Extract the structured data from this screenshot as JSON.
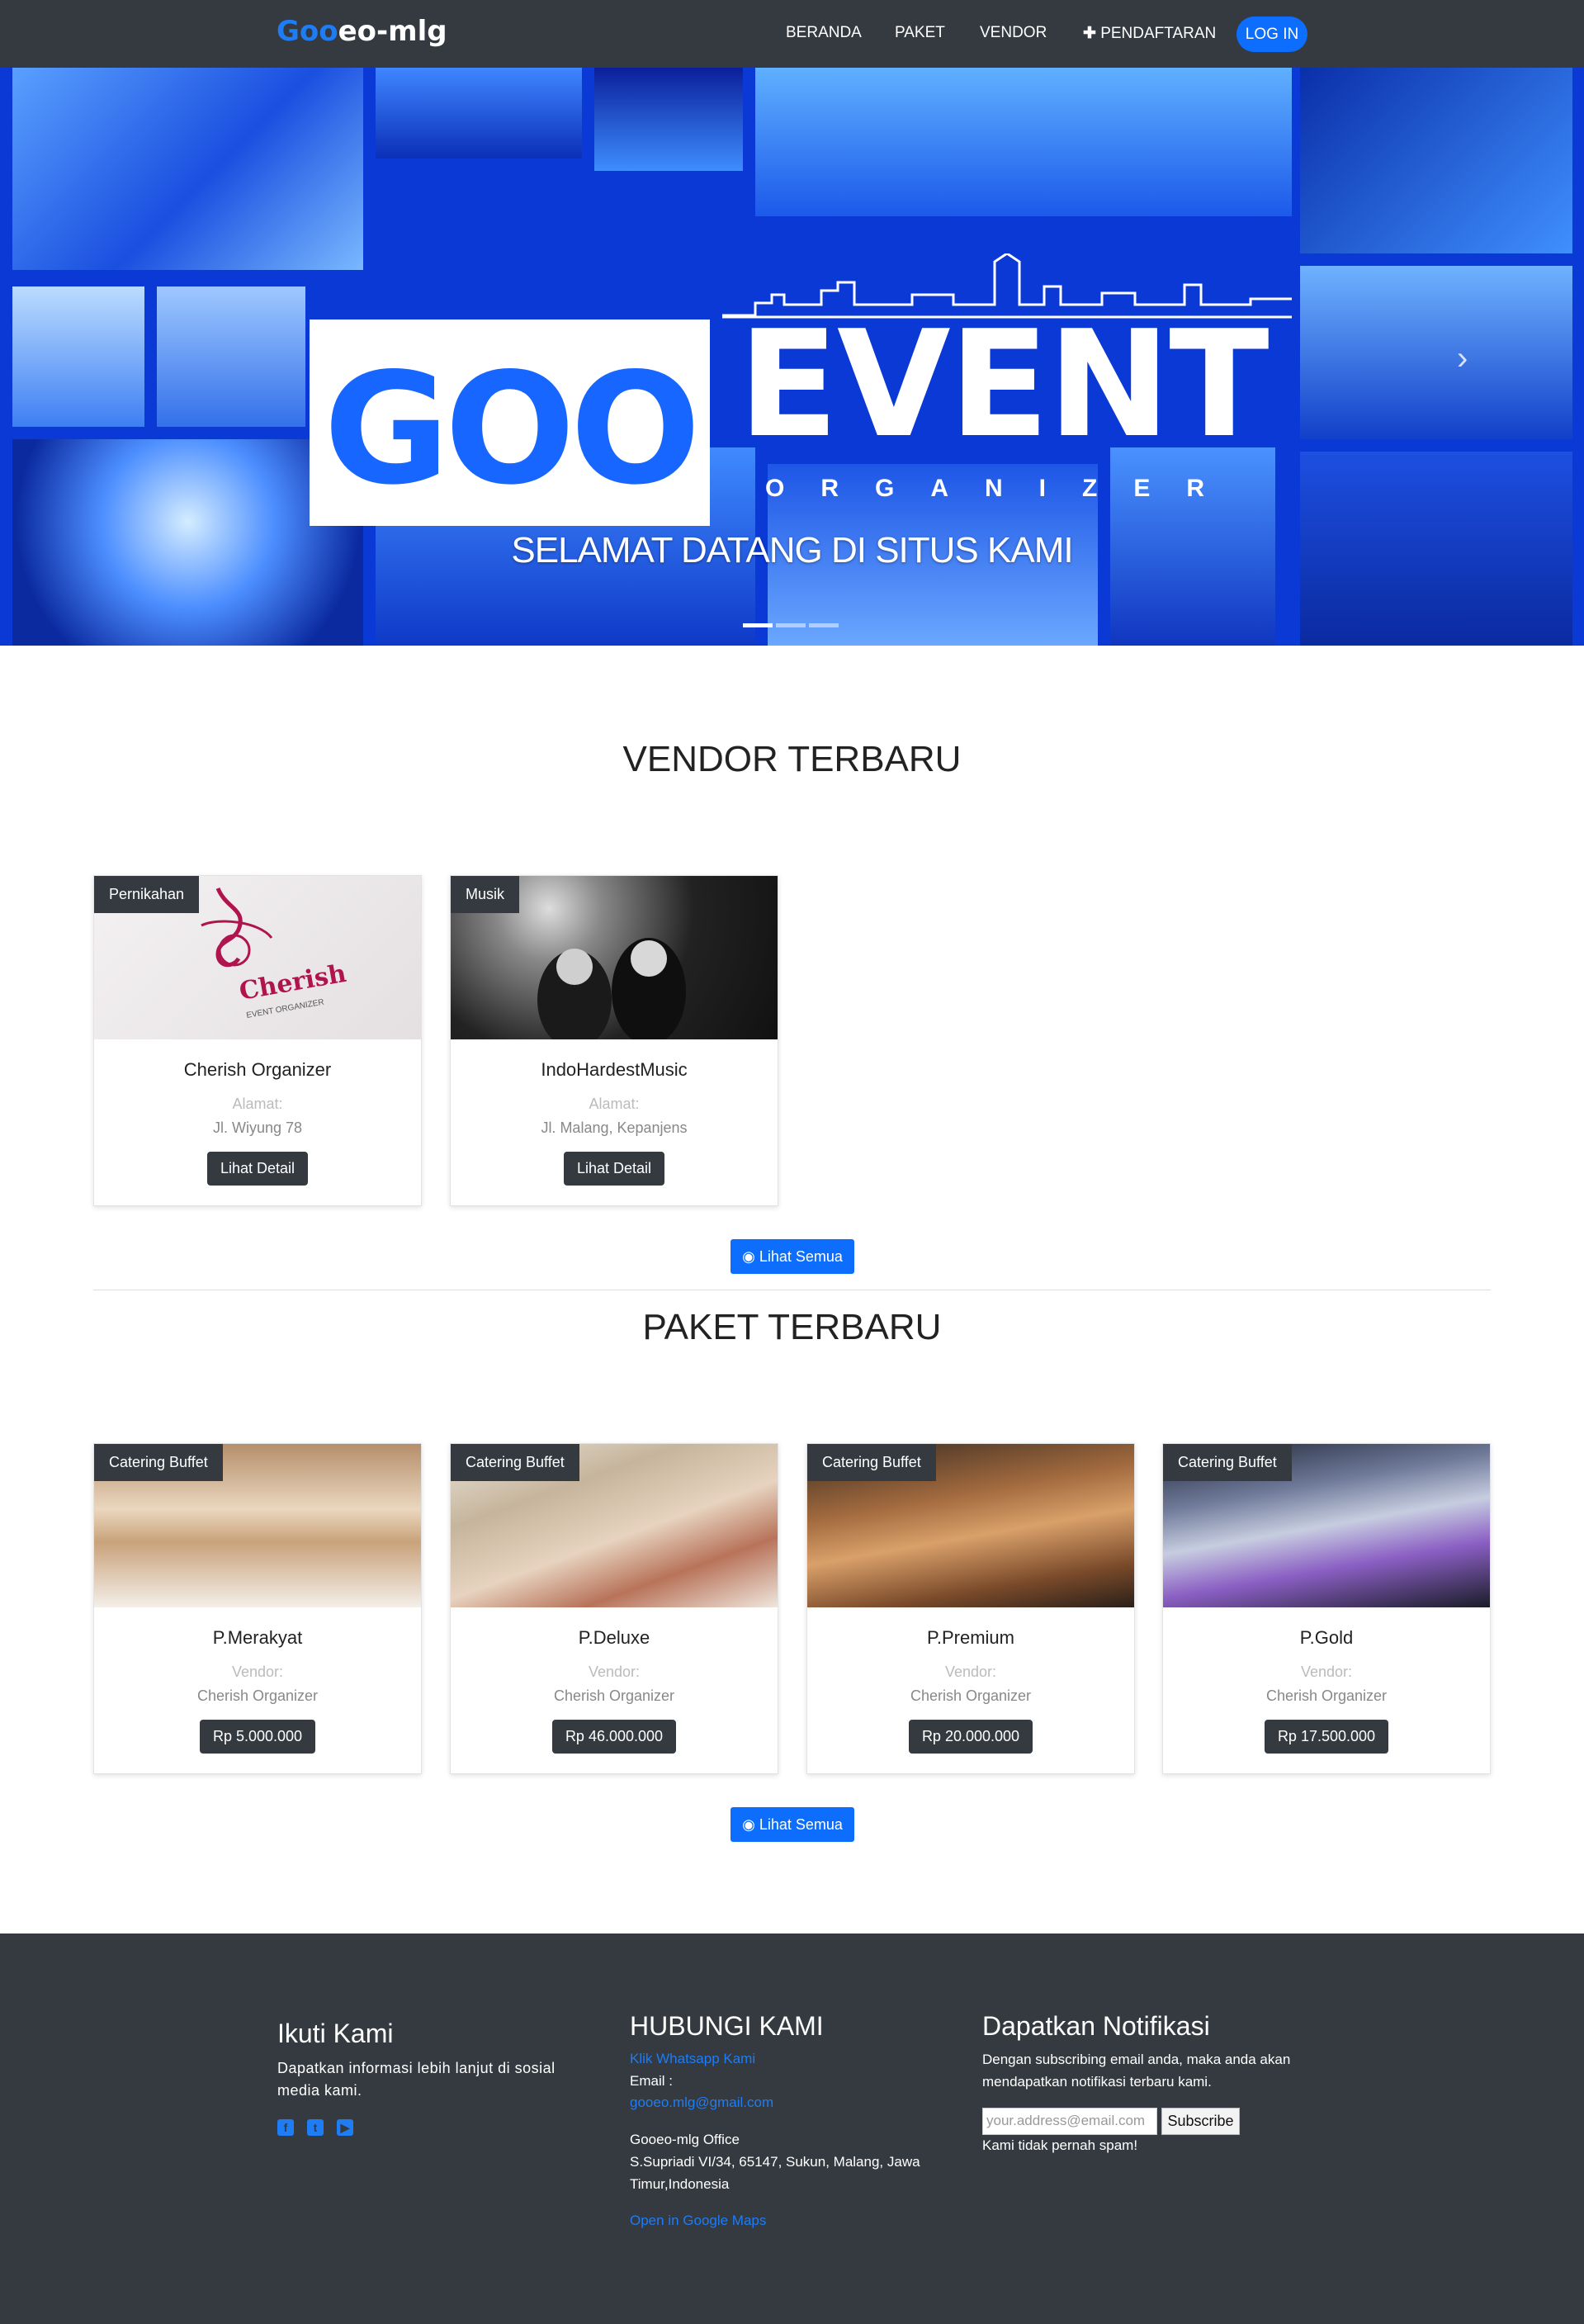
{
  "navbar": {
    "brand_part1": "Goo",
    "brand_part2": "eo-mlg",
    "items": [
      "BERANDA",
      "PAKET",
      "VENDOR",
      "PENDAFTARAN"
    ],
    "login": "LOG IN",
    "plus_icon": "plus-icon"
  },
  "hero": {
    "logo_goo": "GOO",
    "logo_event": "EVENT",
    "logo_organizer": "ORGANIZER",
    "caption": "SELAMAT DATANG DI SITUS KAMI",
    "slide_count": 3,
    "active_slide": 1
  },
  "vendor_section": {
    "title": "VENDOR TERBARU",
    "address_label": "Alamat:",
    "detail_label": "Lihat Detail",
    "items": [
      {
        "category": "Pernikahan",
        "name": "Cherish Organizer",
        "address": "Jl. Wiyung 78"
      },
      {
        "category": "Musik",
        "name": "IndoHardestMusic",
        "address": "Jl. Malang, Kepanjens"
      }
    ],
    "see_all": "Lihat Semua"
  },
  "package_section": {
    "title": "PAKET TERBARU",
    "vendor_label": "Vendor:",
    "items": [
      {
        "category": "Catering Buffet",
        "name": "P.Merakyat",
        "vendor": "Cherish Organizer",
        "price": "Rp 5.000.000"
      },
      {
        "category": "Catering Buffet",
        "name": "P.Deluxe",
        "vendor": "Cherish Organizer",
        "price": "Rp 46.000.000"
      },
      {
        "category": "Catering Buffet",
        "name": "P.Premium",
        "vendor": "Cherish Organizer",
        "price": "Rp 20.000.000"
      },
      {
        "category": "Catering Buffet",
        "name": "P.Gold",
        "vendor": "Cherish Organizer",
        "price": "Rp 17.500.000"
      }
    ],
    "see_all": "Lihat Semua"
  },
  "footer": {
    "follow_title": "Ikuti Kami",
    "follow_text_1": "Dapatkan informasi lebih lanjut di sosial",
    "follow_text_2": "media kami.",
    "social_icons": [
      "facebook-icon",
      "twitter-icon",
      "youtube-icon"
    ],
    "contact_title": "HUBUNGI KAMI",
    "whatsapp_link": "Klik Whatsapp Kami",
    "email_label": "Email :",
    "email": "gooeo.mlg@gmail.com",
    "office_name": "Gooeo-mlg Office",
    "office_addr_1": "S.Supriadi VI/34, 65147, Sukun, Malang, Jawa",
    "office_addr_2": "Timur,Indonesia",
    "maps_link": "Open in Google Maps",
    "notif_title": "Dapatkan Notifikasi",
    "notif_text_1": "Dengan subscribing email anda, maka anda akan",
    "notif_text_2": "mendapatkan notifikasi terbaru kami.",
    "email_placeholder": "your.address@email.com",
    "subscribe": "Subscribe",
    "no_spam": "Kami tidak pernah spam!"
  },
  "colors": {
    "navbar_bg": "#343a40",
    "accent": "#0d6efd",
    "hero_blue": "#0a39d6",
    "footer_bg": "#343a40"
  }
}
